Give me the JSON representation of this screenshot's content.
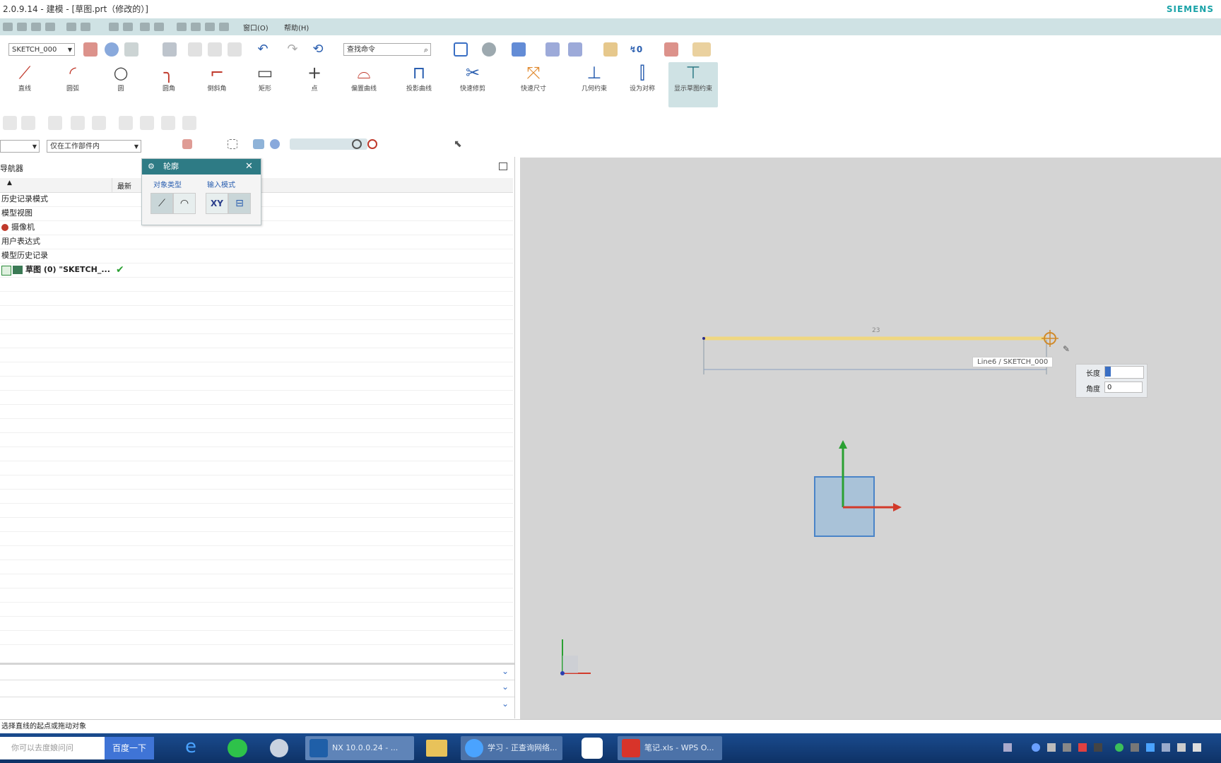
{
  "window": {
    "title": "2.0.9.14 - 建模 - [草图.prt（修改的）]",
    "brand": "SIEMENS"
  },
  "menubar": {
    "items": [
      "窗口(O)",
      "帮助(H)"
    ]
  },
  "quickbar": {
    "sketch_name": "SKETCH_000",
    "command_search": "查找命令"
  },
  "ribbon": {
    "buttons": [
      {
        "label": "直线",
        "icon": "line-icon"
      },
      {
        "label": "圆弧",
        "icon": "arc-icon"
      },
      {
        "label": "圆",
        "icon": "circle-icon"
      },
      {
        "label": "圆角",
        "icon": "fillet-icon"
      },
      {
        "label": "倒斜角",
        "icon": "chamfer-icon"
      },
      {
        "label": "矩形",
        "icon": "rectangle-icon"
      },
      {
        "label": "点",
        "icon": "point-icon"
      },
      {
        "label": "偏置曲线",
        "icon": "offset-curve-icon"
      },
      {
        "label": "投影曲线",
        "icon": "project-curve-icon"
      },
      {
        "label": "快速修剪",
        "icon": "quick-trim-icon"
      },
      {
        "label": "快速尺寸",
        "icon": "rapid-dimension-icon"
      },
      {
        "label": "几何约束",
        "icon": "geometric-constraint-icon"
      },
      {
        "label": "设为对称",
        "icon": "symmetric-icon"
      },
      {
        "label": "显示草图约束",
        "icon": "show-constraints-icon"
      }
    ]
  },
  "selection_bar": {
    "filter": "",
    "scope": "仅在工作部件内"
  },
  "navigator": {
    "title": "导航器",
    "column_latest": "最新",
    "items": [
      {
        "label": "历史记录模式"
      },
      {
        "label": "模型视图"
      },
      {
        "label": "摄像机"
      },
      {
        "label": "用户表达式"
      },
      {
        "label": "模型历史记录"
      },
      {
        "label": "草图 (0) \"SKETCH_..."
      }
    ]
  },
  "dialog": {
    "title": "轮廓",
    "object_type_label": "对象类型",
    "input_mode_label": "输入模式",
    "xy_label": "XY"
  },
  "graphics": {
    "tooltip": "Line6 / SKETCH_000",
    "dim_label": "23",
    "length_label": "长度",
    "length_value": "",
    "angle_label": "角度",
    "angle_value": "0"
  },
  "status": {
    "text": "选择直线的起点或拖动对象"
  },
  "taskbar": {
    "search_placeholder": "你可以去度娘问问",
    "search_button": "百度一下",
    "tasks": [
      {
        "label": "NX 10.0.0.24 - ...",
        "icon": "nx-icon"
      },
      {
        "label": "",
        "icon": "folder-icon"
      },
      {
        "label": "学习 - 正查询网络...",
        "icon": "ie-icon"
      },
      {
        "label": "",
        "icon": "baidu-netdisk-icon"
      },
      {
        "label": "笔记.xls - WPS O...",
        "icon": "wps-icon"
      }
    ]
  },
  "colors": {
    "menubar": "#cfe2e4",
    "accent": "#2e7b85",
    "highlight_line": "#f0d878",
    "taskbar": "#0e3266"
  }
}
